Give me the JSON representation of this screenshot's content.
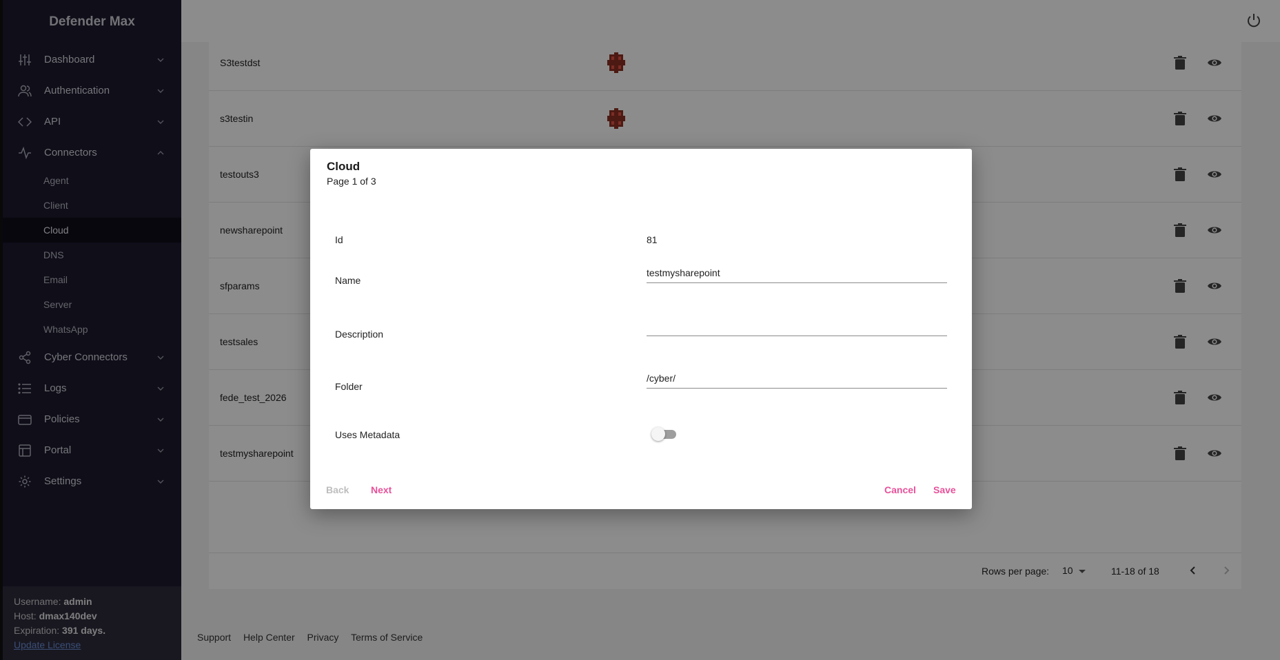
{
  "app": {
    "title": "Defender Max"
  },
  "sidebar": {
    "items": [
      {
        "label": "Dashboard"
      },
      {
        "label": "Authentication"
      },
      {
        "label": "API"
      },
      {
        "label": "Connectors"
      },
      {
        "label": "Cyber Connectors"
      },
      {
        "label": "Logs"
      },
      {
        "label": "Policies"
      },
      {
        "label": "Portal"
      },
      {
        "label": "Settings"
      }
    ],
    "connectors_sub": [
      {
        "label": "Agent"
      },
      {
        "label": "Client"
      },
      {
        "label": "Cloud"
      },
      {
        "label": "DNS"
      },
      {
        "label": "Email"
      },
      {
        "label": "Server"
      },
      {
        "label": "WhatsApp"
      }
    ]
  },
  "user": {
    "username_label": "Username:",
    "username": "admin",
    "host_label": "Host:",
    "host": "dmax140dev",
    "expiration_label": "Expiration:",
    "expiration": "391 days.",
    "update_license": "Update License"
  },
  "table": {
    "rows": [
      {
        "name": "S3testdst"
      },
      {
        "name": "s3testin"
      },
      {
        "name": "testouts3"
      },
      {
        "name": "newsharepoint"
      },
      {
        "name": "sfparams"
      },
      {
        "name": "testsales"
      },
      {
        "name": "fede_test_2026"
      },
      {
        "name": "testmysharepoint"
      }
    ],
    "rows_per_page_label": "Rows per page:",
    "rows_per_page": "10",
    "range": "11-18 of 18"
  },
  "footer": {
    "links": [
      "Support",
      "Help Center",
      "Privacy",
      "Terms of Service"
    ]
  },
  "dialog": {
    "title": "Cloud",
    "subtitle": "Page 1 of 3",
    "id_label": "Id",
    "id_value": "81",
    "name_label": "Name",
    "name_value": "testmysharepoint",
    "description_label": "Description",
    "description_value": "",
    "folder_label": "Folder",
    "folder_value": "/cyber/",
    "metadata_label": "Uses Metadata",
    "back": "Back",
    "next": "Next",
    "cancel": "Cancel",
    "save": "Save"
  },
  "colors": {
    "accent": "#e8519a",
    "sidebar_bg": "#1c1a2e",
    "link": "#6a8ed8"
  }
}
